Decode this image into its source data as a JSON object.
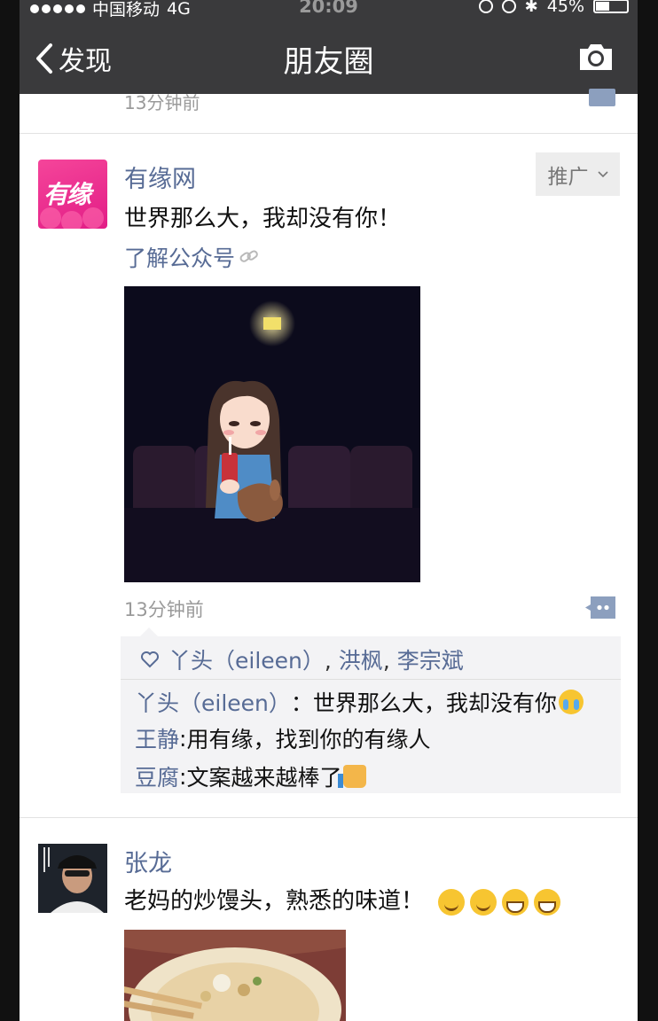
{
  "status_bar": {
    "carrier": "中国移动",
    "network": "4G",
    "time": "20:09",
    "battery": "45%",
    "battery_level": 0.45
  },
  "nav": {
    "back_label": "发现",
    "title": "朋友圈",
    "camera_icon": "camera-icon"
  },
  "previous_post": {
    "time": "13分钟前"
  },
  "ad_post": {
    "author": "有缘网",
    "avatar_text": "有缘",
    "tag_label": "推广",
    "text": "世界那么大，我却没有你！",
    "link_label": "了解公众号",
    "time": "13分钟前",
    "likes": [
      "丫头（eileen）",
      "洪枫",
      "李宗斌"
    ],
    "comments": [
      {
        "who": "丫头（eileen）",
        "sep": "：",
        "text": "世界那么大，我却没有你",
        "emoji": "crying-face"
      },
      {
        "who": "王静",
        "sep": ": ",
        "text": "用有缘，找到你的有缘人",
        "emoji": ""
      },
      {
        "who": "豆腐",
        "sep": ": ",
        "text": "文案越来越棒了",
        "emoji": "thumbs-up"
      }
    ]
  },
  "post2": {
    "author": "张龙",
    "text": "老妈的炒馒头，熟悉的味道！",
    "emojis": [
      "smile",
      "smile",
      "grin",
      "grin"
    ]
  },
  "colors": {
    "nav_bg": "#3a3a3c",
    "link_blue": "#576b95",
    "timestamp_gray": "#9a9a9a",
    "brand_pink": "#e21d86"
  }
}
